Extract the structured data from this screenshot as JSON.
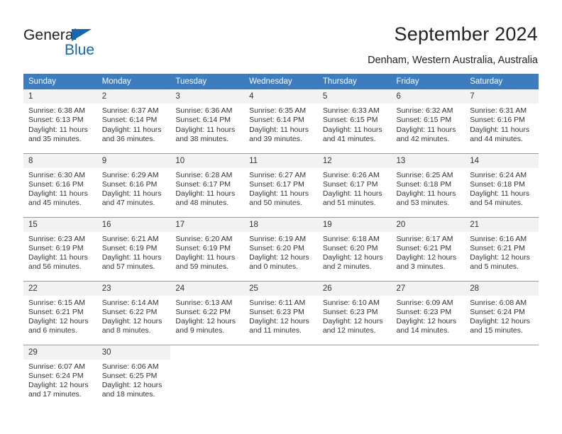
{
  "brand": {
    "word_one": "General",
    "word_two": "Blue",
    "triangle_color": "#1268b3"
  },
  "header": {
    "title": "September 2024",
    "subtitle": "Denham, Western Australia, Australia",
    "accent_color": "#3d7cbf",
    "daynum_band_color": "#f2f2f2"
  },
  "weekdays": [
    "Sunday",
    "Monday",
    "Tuesday",
    "Wednesday",
    "Thursday",
    "Friday",
    "Saturday"
  ],
  "labels": {
    "sunrise_prefix": "Sunrise:",
    "sunset_prefix": "Sunset:",
    "daylight_prefix": "Daylight:"
  },
  "weeks": [
    [
      {
        "day": "1",
        "sunrise": "Sunrise: 6:38 AM",
        "sunset": "Sunset: 6:13 PM",
        "daylight_line1": "Daylight: 11 hours",
        "daylight_line2": "and 35 minutes."
      },
      {
        "day": "2",
        "sunrise": "Sunrise: 6:37 AM",
        "sunset": "Sunset: 6:14 PM",
        "daylight_line1": "Daylight: 11 hours",
        "daylight_line2": "and 36 minutes."
      },
      {
        "day": "3",
        "sunrise": "Sunrise: 6:36 AM",
        "sunset": "Sunset: 6:14 PM",
        "daylight_line1": "Daylight: 11 hours",
        "daylight_line2": "and 38 minutes."
      },
      {
        "day": "4",
        "sunrise": "Sunrise: 6:35 AM",
        "sunset": "Sunset: 6:14 PM",
        "daylight_line1": "Daylight: 11 hours",
        "daylight_line2": "and 39 minutes."
      },
      {
        "day": "5",
        "sunrise": "Sunrise: 6:33 AM",
        "sunset": "Sunset: 6:15 PM",
        "daylight_line1": "Daylight: 11 hours",
        "daylight_line2": "and 41 minutes."
      },
      {
        "day": "6",
        "sunrise": "Sunrise: 6:32 AM",
        "sunset": "Sunset: 6:15 PM",
        "daylight_line1": "Daylight: 11 hours",
        "daylight_line2": "and 42 minutes."
      },
      {
        "day": "7",
        "sunrise": "Sunrise: 6:31 AM",
        "sunset": "Sunset: 6:16 PM",
        "daylight_line1": "Daylight: 11 hours",
        "daylight_line2": "and 44 minutes."
      }
    ],
    [
      {
        "day": "8",
        "sunrise": "Sunrise: 6:30 AM",
        "sunset": "Sunset: 6:16 PM",
        "daylight_line1": "Daylight: 11 hours",
        "daylight_line2": "and 45 minutes."
      },
      {
        "day": "9",
        "sunrise": "Sunrise: 6:29 AM",
        "sunset": "Sunset: 6:16 PM",
        "daylight_line1": "Daylight: 11 hours",
        "daylight_line2": "and 47 minutes."
      },
      {
        "day": "10",
        "sunrise": "Sunrise: 6:28 AM",
        "sunset": "Sunset: 6:17 PM",
        "daylight_line1": "Daylight: 11 hours",
        "daylight_line2": "and 48 minutes."
      },
      {
        "day": "11",
        "sunrise": "Sunrise: 6:27 AM",
        "sunset": "Sunset: 6:17 PM",
        "daylight_line1": "Daylight: 11 hours",
        "daylight_line2": "and 50 minutes."
      },
      {
        "day": "12",
        "sunrise": "Sunrise: 6:26 AM",
        "sunset": "Sunset: 6:17 PM",
        "daylight_line1": "Daylight: 11 hours",
        "daylight_line2": "and 51 minutes."
      },
      {
        "day": "13",
        "sunrise": "Sunrise: 6:25 AM",
        "sunset": "Sunset: 6:18 PM",
        "daylight_line1": "Daylight: 11 hours",
        "daylight_line2": "and 53 minutes."
      },
      {
        "day": "14",
        "sunrise": "Sunrise: 6:24 AM",
        "sunset": "Sunset: 6:18 PM",
        "daylight_line1": "Daylight: 11 hours",
        "daylight_line2": "and 54 minutes."
      }
    ],
    [
      {
        "day": "15",
        "sunrise": "Sunrise: 6:23 AM",
        "sunset": "Sunset: 6:19 PM",
        "daylight_line1": "Daylight: 11 hours",
        "daylight_line2": "and 56 minutes."
      },
      {
        "day": "16",
        "sunrise": "Sunrise: 6:21 AM",
        "sunset": "Sunset: 6:19 PM",
        "daylight_line1": "Daylight: 11 hours",
        "daylight_line2": "and 57 minutes."
      },
      {
        "day": "17",
        "sunrise": "Sunrise: 6:20 AM",
        "sunset": "Sunset: 6:19 PM",
        "daylight_line1": "Daylight: 11 hours",
        "daylight_line2": "and 59 minutes."
      },
      {
        "day": "18",
        "sunrise": "Sunrise: 6:19 AM",
        "sunset": "Sunset: 6:20 PM",
        "daylight_line1": "Daylight: 12 hours",
        "daylight_line2": "and 0 minutes."
      },
      {
        "day": "19",
        "sunrise": "Sunrise: 6:18 AM",
        "sunset": "Sunset: 6:20 PM",
        "daylight_line1": "Daylight: 12 hours",
        "daylight_line2": "and 2 minutes."
      },
      {
        "day": "20",
        "sunrise": "Sunrise: 6:17 AM",
        "sunset": "Sunset: 6:21 PM",
        "daylight_line1": "Daylight: 12 hours",
        "daylight_line2": "and 3 minutes."
      },
      {
        "day": "21",
        "sunrise": "Sunrise: 6:16 AM",
        "sunset": "Sunset: 6:21 PM",
        "daylight_line1": "Daylight: 12 hours",
        "daylight_line2": "and 5 minutes."
      }
    ],
    [
      {
        "day": "22",
        "sunrise": "Sunrise: 6:15 AM",
        "sunset": "Sunset: 6:21 PM",
        "daylight_line1": "Daylight: 12 hours",
        "daylight_line2": "and 6 minutes."
      },
      {
        "day": "23",
        "sunrise": "Sunrise: 6:14 AM",
        "sunset": "Sunset: 6:22 PM",
        "daylight_line1": "Daylight: 12 hours",
        "daylight_line2": "and 8 minutes."
      },
      {
        "day": "24",
        "sunrise": "Sunrise: 6:13 AM",
        "sunset": "Sunset: 6:22 PM",
        "daylight_line1": "Daylight: 12 hours",
        "daylight_line2": "and 9 minutes."
      },
      {
        "day": "25",
        "sunrise": "Sunrise: 6:11 AM",
        "sunset": "Sunset: 6:23 PM",
        "daylight_line1": "Daylight: 12 hours",
        "daylight_line2": "and 11 minutes."
      },
      {
        "day": "26",
        "sunrise": "Sunrise: 6:10 AM",
        "sunset": "Sunset: 6:23 PM",
        "daylight_line1": "Daylight: 12 hours",
        "daylight_line2": "and 12 minutes."
      },
      {
        "day": "27",
        "sunrise": "Sunrise: 6:09 AM",
        "sunset": "Sunset: 6:23 PM",
        "daylight_line1": "Daylight: 12 hours",
        "daylight_line2": "and 14 minutes."
      },
      {
        "day": "28",
        "sunrise": "Sunrise: 6:08 AM",
        "sunset": "Sunset: 6:24 PM",
        "daylight_line1": "Daylight: 12 hours",
        "daylight_line2": "and 15 minutes."
      }
    ],
    [
      {
        "day": "29",
        "sunrise": "Sunrise: 6:07 AM",
        "sunset": "Sunset: 6:24 PM",
        "daylight_line1": "Daylight: 12 hours",
        "daylight_line2": "and 17 minutes."
      },
      {
        "day": "30",
        "sunrise": "Sunrise: 6:06 AM",
        "sunset": "Sunset: 6:25 PM",
        "daylight_line1": "Daylight: 12 hours",
        "daylight_line2": "and 18 minutes."
      },
      {
        "day": "",
        "sunrise": "",
        "sunset": "",
        "daylight_line1": "",
        "daylight_line2": ""
      },
      {
        "day": "",
        "sunrise": "",
        "sunset": "",
        "daylight_line1": "",
        "daylight_line2": ""
      },
      {
        "day": "",
        "sunrise": "",
        "sunset": "",
        "daylight_line1": "",
        "daylight_line2": ""
      },
      {
        "day": "",
        "sunrise": "",
        "sunset": "",
        "daylight_line1": "",
        "daylight_line2": ""
      },
      {
        "day": "",
        "sunrise": "",
        "sunset": "",
        "daylight_line1": "",
        "daylight_line2": ""
      }
    ]
  ]
}
